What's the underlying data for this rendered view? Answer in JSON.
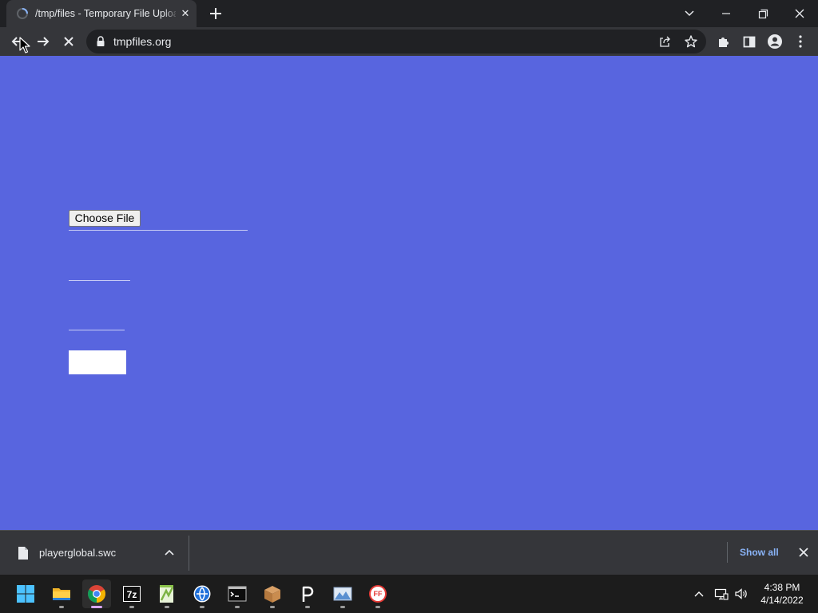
{
  "browser": {
    "tab": {
      "title": "/tmp/files - Temporary File Uploader",
      "close_glyph": "✕"
    },
    "address_bar": {
      "url": "tmpfiles.org"
    }
  },
  "page": {
    "choose_file_label": "Choose File"
  },
  "download_shelf": {
    "filename": "playerglobal.swc",
    "show_all_label": "Show all"
  },
  "taskbar": {
    "apps": [
      "start-icon",
      "file-explorer-icon",
      "chrome-icon",
      "7zip-icon",
      "notepad-plus-icon",
      "vpn-globe-icon",
      "terminal-icon",
      "package-box-icon",
      "p-app-icon",
      "image-viewer-icon",
      "ffdec-icon"
    ],
    "clock": {
      "time": "4:38 PM",
      "date": "4/14/2022"
    }
  },
  "colors": {
    "page_background": "#5865df",
    "browser_frame": "#202124",
    "toolbar": "#35363a",
    "link_accent": "#8ab4f8"
  }
}
